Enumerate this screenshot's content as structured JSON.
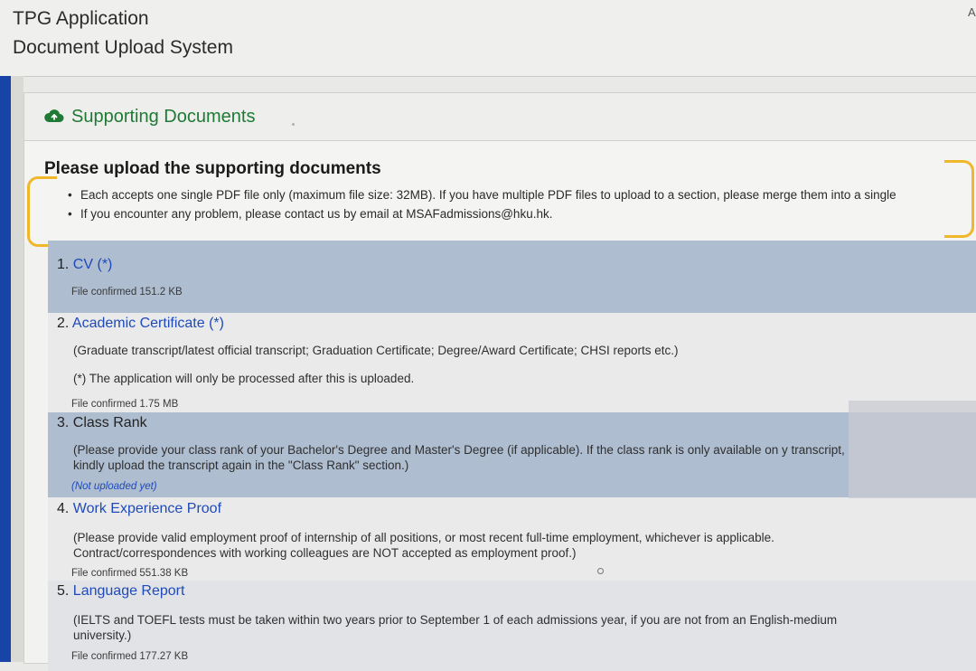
{
  "header": {
    "title": "TPG Application",
    "subtitle": "Document Upload System",
    "corner_letter": "A"
  },
  "panel": {
    "title": "Supporting Documents",
    "icon": "cloud-upload-icon",
    "accent_color": "#1e7a34"
  },
  "intro": {
    "heading": "Please upload the supporting documents",
    "bullets": [
      "Each accepts one single PDF file only (maximum file size: 32MB). If you have multiple PDF files to upload to a section, please merge them into a single",
      "If you encounter any problem, please contact us by email at MSAFadmissions@hku.hk."
    ]
  },
  "documents": [
    {
      "number": "1.",
      "name": "CV",
      "required_mark": "(*)",
      "description": "",
      "note": "",
      "status": "File confirmed 151.2 KB"
    },
    {
      "number": "2.",
      "name": "Academic Certificate",
      "required_mark": "(*)",
      "description": "(Graduate transcript/latest official transcript; Graduation Certificate; Degree/Award Certificate; CHSI reports etc.)",
      "note": "(*) The application will only be processed after this is uploaded.",
      "status": "File confirmed 1.75 MB"
    },
    {
      "number": "3.",
      "name": "Class Rank",
      "required_mark": "",
      "description": "(Please provide your class rank of your Bachelor's Degree and Master's Degree (if applicable). If the class rank is only available on y transcript, kindly upload the transcript again in the \"Class Rank\" section.)",
      "note": "",
      "status": "(Not uploaded yet)"
    },
    {
      "number": "4.",
      "name": "Work Experience Proof",
      "required_mark": "",
      "description": "(Please provide valid employment proof of internship of all positions, or most recent full-time employment, whichever is applicable. Contract/correspondences with working colleagues are NOT accepted as employment proof.)",
      "note": "",
      "status": "File confirmed 551.38 KB"
    },
    {
      "number": "5.",
      "name": "Language Report",
      "required_mark": "",
      "description": "(IELTS and TOEFL tests must be taken within two years prior to September 1 of each admissions year, if you are not from an English-medium university.)",
      "note": "",
      "status": "File confirmed 177.27 KB"
    }
  ]
}
